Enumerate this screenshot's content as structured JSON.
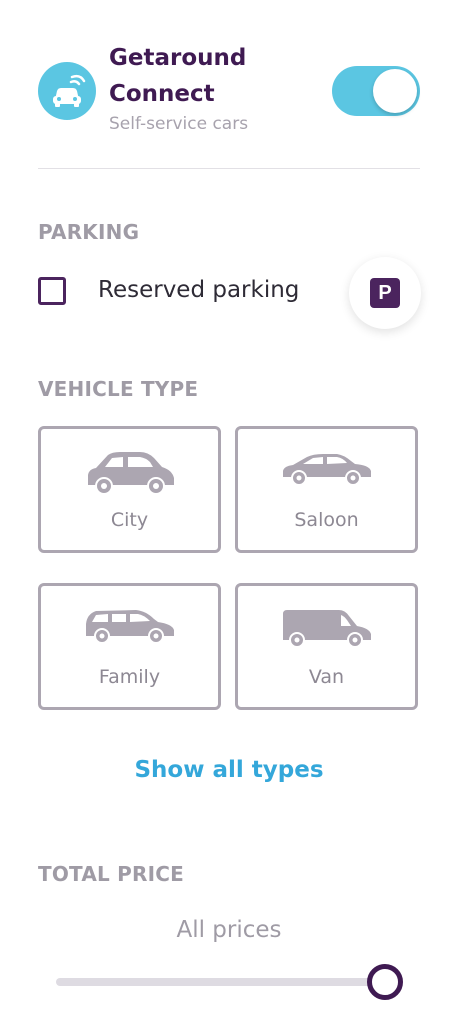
{
  "connect": {
    "title_line1": "Getaround",
    "title_line2": "Connect",
    "subtitle": "Self-service cars",
    "toggle_on": true,
    "icon": "connected-car-icon"
  },
  "parking": {
    "section_title": "PARKING",
    "option_label": "Reserved parking",
    "checked": false,
    "badge_letter": "P"
  },
  "vehicle_type": {
    "section_title": "VEHICLE TYPE",
    "types": [
      {
        "label": "City",
        "icon": "city-car-icon"
      },
      {
        "label": "Saloon",
        "icon": "saloon-car-icon"
      },
      {
        "label": "Family",
        "icon": "family-car-icon"
      },
      {
        "label": "Van",
        "icon": "van-icon"
      }
    ],
    "show_all": "Show all types"
  },
  "price": {
    "section_title": "TOTAL PRICE",
    "value_label": "All prices",
    "slider_fraction": 1.0
  },
  "colors": {
    "brand_purple": "#3f1a52",
    "accent_cyan": "#5bc6e2",
    "link_blue": "#34a7da",
    "muted_gray": "#9f9ba5"
  }
}
